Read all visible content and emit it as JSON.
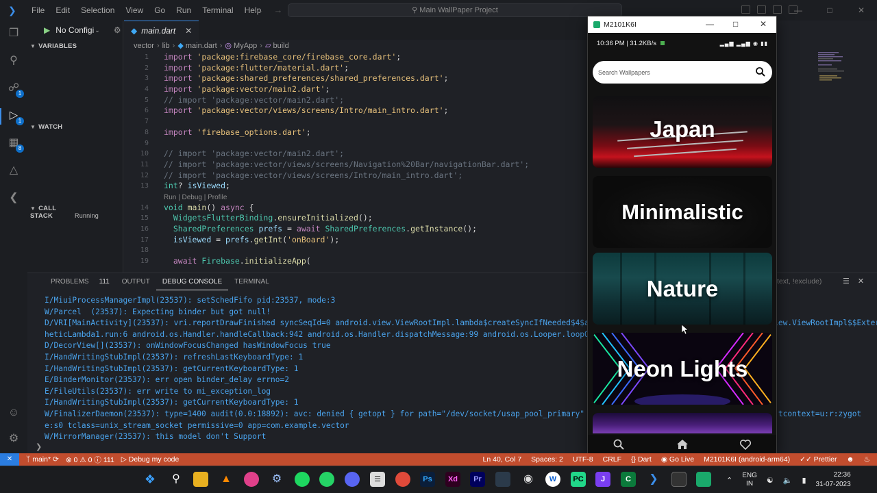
{
  "vscode": {
    "menus": [
      "File",
      "Edit",
      "Selection",
      "View",
      "Go",
      "Run",
      "Terminal",
      "Help"
    ],
    "command_center": "Main WallPaper Project",
    "run_config": "No Configi",
    "sidebar_sections": {
      "variables": "VARIABLES",
      "watch": "WATCH",
      "call_stack": "CALL STACK",
      "call_stack_status": "Running"
    },
    "activity_badges": {
      "source_control": "1",
      "extensions": "8",
      "run": "1"
    },
    "tab": {
      "name": "main.dart"
    },
    "breadcrumb": {
      "folder1": "vector",
      "folder2": "lib",
      "file": "main.dart",
      "cls": "MyApp",
      "method": "build"
    },
    "code_lines": [
      {
        "n": "1",
        "parts": [
          [
            "kw",
            "import "
          ],
          [
            "str",
            "'package:firebase_core/firebase_core.dart'"
          ],
          [
            "plain",
            ";"
          ]
        ]
      },
      {
        "n": "2",
        "parts": [
          [
            "kw",
            "import "
          ],
          [
            "str",
            "'package:flutter/material.dart'"
          ],
          [
            "plain",
            ";"
          ]
        ]
      },
      {
        "n": "3",
        "parts": [
          [
            "kw",
            "import "
          ],
          [
            "str",
            "'package:shared_preferences/shared_preferences.dart'"
          ],
          [
            "plain",
            ";"
          ]
        ]
      },
      {
        "n": "4",
        "parts": [
          [
            "kw",
            "import "
          ],
          [
            "str",
            "'package:vector/main2.dart'"
          ],
          [
            "plain",
            ";"
          ]
        ]
      },
      {
        "n": "5",
        "parts": [
          [
            "cm",
            "// import 'package:vector/main2.dart';"
          ]
        ]
      },
      {
        "n": "6",
        "parts": [
          [
            "kw",
            "import "
          ],
          [
            "str",
            "'package:vector/views/screens/Intro/main_intro.dart'"
          ],
          [
            "plain",
            ";"
          ]
        ]
      },
      {
        "n": "7",
        "parts": []
      },
      {
        "n": "8",
        "parts": [
          [
            "kw",
            "import "
          ],
          [
            "str",
            "'firebase_options.dart'"
          ],
          [
            "plain",
            ";"
          ]
        ]
      },
      {
        "n": "9",
        "parts": []
      },
      {
        "n": "10",
        "parts": [
          [
            "cm",
            "// import 'package:vector/main2.dart';"
          ]
        ]
      },
      {
        "n": "11",
        "parts": [
          [
            "cm",
            "// import 'package:vector/views/screens/Navigation%20Bar/navigationBar.dart';"
          ]
        ]
      },
      {
        "n": "12",
        "parts": [
          [
            "cm",
            "// import 'package:vector/views/screens/Intro/main_intro.dart';"
          ]
        ]
      },
      {
        "n": "13",
        "parts": [
          [
            "ty",
            "int"
          ],
          [
            "plain",
            "? "
          ],
          [
            "var",
            "isViewed"
          ],
          [
            "plain",
            ";"
          ]
        ]
      },
      {
        "n": "",
        "parts": [
          [
            "lens",
            "Run | Debug | Profile"
          ]
        ]
      },
      {
        "n": "14",
        "parts": [
          [
            "ty",
            "void "
          ],
          [
            "fn",
            "main"
          ],
          [
            "plain",
            "() "
          ],
          [
            "kw",
            "async "
          ],
          [
            "plain",
            "{"
          ]
        ]
      },
      {
        "n": "15",
        "parts": [
          [
            "plain",
            "  "
          ],
          [
            "ty",
            "WidgetsFlutterBinding"
          ],
          [
            "plain",
            "."
          ],
          [
            "fn",
            "ensureInitialized"
          ],
          [
            "plain",
            "();"
          ]
        ]
      },
      {
        "n": "16",
        "parts": [
          [
            "plain",
            "  "
          ],
          [
            "ty",
            "SharedPreferences "
          ],
          [
            "var",
            "prefs "
          ],
          [
            "plain",
            "= "
          ],
          [
            "kw",
            "await "
          ],
          [
            "ty",
            "SharedPreferences"
          ],
          [
            "plain",
            "."
          ],
          [
            "fn",
            "getInstance"
          ],
          [
            "plain",
            "();"
          ]
        ]
      },
      {
        "n": "17",
        "parts": [
          [
            "plain",
            "  "
          ],
          [
            "var",
            "isViewed "
          ],
          [
            "plain",
            "= "
          ],
          [
            "var",
            "prefs"
          ],
          [
            "plain",
            "."
          ],
          [
            "fn",
            "getInt"
          ],
          [
            "plain",
            "("
          ],
          [
            "str",
            "'onBoard'"
          ],
          [
            "plain",
            ");"
          ]
        ]
      },
      {
        "n": "18",
        "parts": []
      },
      {
        "n": "19",
        "parts": [
          [
            "plain",
            "  "
          ],
          [
            "kw",
            "await "
          ],
          [
            "ty",
            "Firebase"
          ],
          [
            "plain",
            "."
          ],
          [
            "fn",
            "initializeApp"
          ],
          [
            "plain",
            "("
          ]
        ]
      }
    ],
    "panel": {
      "tabs": [
        "PROBLEMS",
        "OUTPUT",
        "DEBUG CONSOLE",
        "TERMINAL"
      ],
      "problems_count": "111",
      "active_tab": "DEBUG CONSOLE",
      "filter_placeholder": "text, !exclude)",
      "console_lines": [
        "I/MiuiProcessManagerImpl(23537): setSchedFifo pid:23537, mode:3",
        "W/Parcel  (23537): Expecting binder but got null!",
        "D/VRI[MainActivity](23537): vri.reportDrawFinished syncSeqId=0 android.view.ViewRootImpl.lambda$createSyncIfNeeded$4$android.view.ViewRootImpl:11454 android.view.ViewRootImpl$$ExternalSynt",
        "heticLambda1.run:6 android.os.Handler.handleCallback:942 android.os.Handler.dispatchMessage:99 android.os.Looper.loopOnce:2",
        "D/DecorView[](23537): onWindowFocusChanged hasWindowFocus true",
        "I/HandWritingStubImpl(23537): refreshLastKeyboardType: 1",
        "I/HandWritingStubImpl(23537): getCurrentKeyboardType: 1",
        "E/BinderMonitor(23537): err open binder_delay errno=2",
        "E/FileUtils(23537): err write to mi_exception_log",
        "I/HandWritingStubImpl(23537): getCurrentKeyboardType: 1",
        "W/FinalizerDaemon(23537): type=1400 audit(0.0:18892): avc: denied { getopt } for path=\"/dev/socket/usap_pool_primary\" sconte                                   tcontext=u:r:zygot",
        "e:s0 tclass=unix_stream_socket permissive=0 app=com.example.vector",
        "W/MirrorManager(23537): this model don't Support"
      ]
    },
    "statusbar": {
      "branch": "main*",
      "errors": "0",
      "warnings": "0",
      "info": "111",
      "debug": "Debug my code",
      "position": "Ln 40, Col 7",
      "spaces": "Spaces: 2",
      "encoding": "UTF-8",
      "eol": "CRLF",
      "language": "Dart",
      "golive": "Go Live",
      "device": "M2101K6I (android-arm64)",
      "prettier": "Prettier"
    }
  },
  "phone": {
    "window_title": "M2101K6I",
    "status_left": "10:36 PM | 31.2KB/s",
    "search_placeholder": "Search Wallpapers",
    "categories": [
      "Japan",
      "Minimalistic",
      "Nature",
      "Neon Lights"
    ]
  },
  "taskbar": {
    "lang1": "ENG",
    "lang2": "IN",
    "time": "22:36",
    "date": "31-07-2023"
  },
  "colors": {
    "statusbar": "#c24d2e",
    "accent": "#3b8eea",
    "console_text": "#4aa3ec"
  }
}
